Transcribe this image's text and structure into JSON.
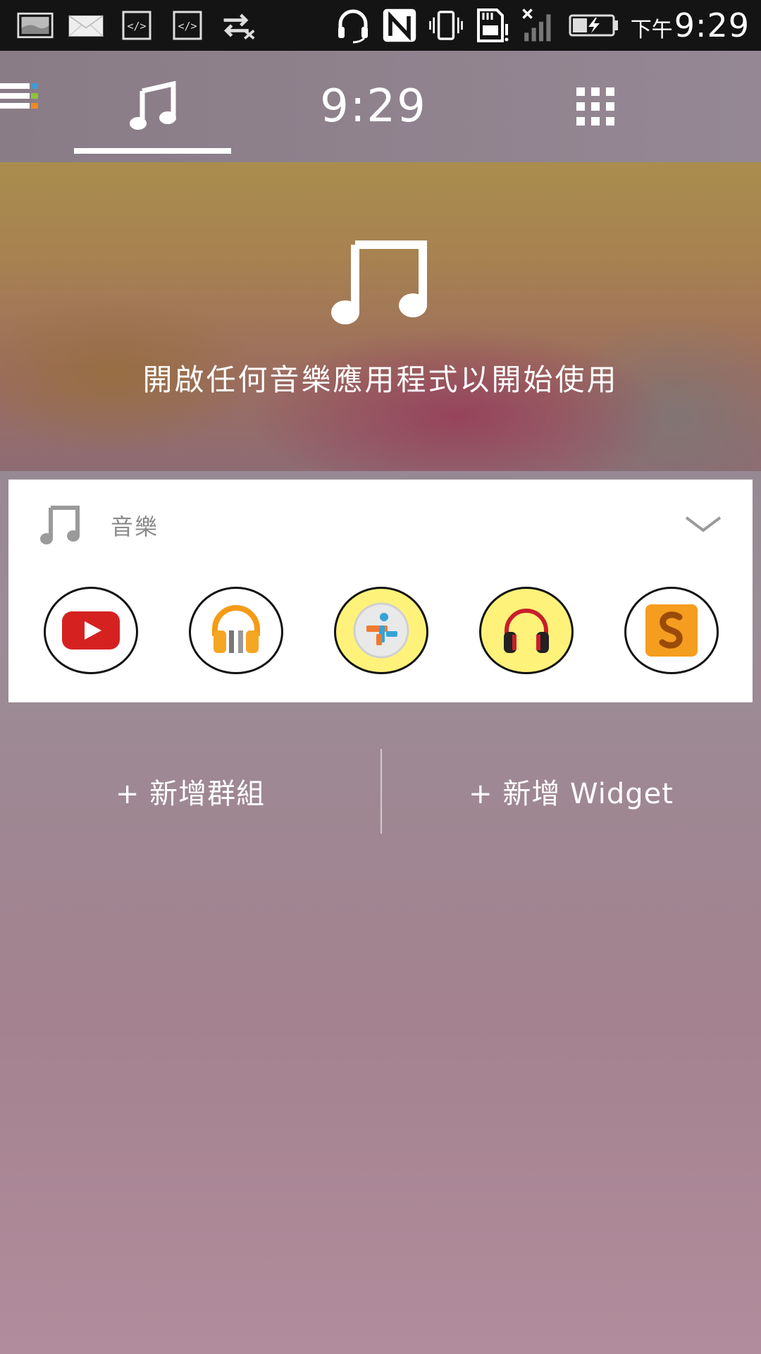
{
  "status_bar": {
    "ampm": "下午",
    "time": "9:29",
    "icons": [
      "image-notification-icon",
      "mail-icon",
      "code-icon",
      "code-icon",
      "data-transfer-icon",
      "headset-icon",
      "nfc-icon",
      "vibrate-icon",
      "sd-card-alert-icon",
      "no-signal-icon",
      "battery-charging-icon"
    ]
  },
  "tabs": {
    "music_icon": "music-note-icon",
    "clock": "9:29",
    "apps_icon": "grid-icon"
  },
  "hero": {
    "message": "開啟任何音樂應用程式以開始使用"
  },
  "music_card": {
    "title": "音樂",
    "apps": [
      "youtube-icon",
      "google-play-music-icon",
      "tunein-icon",
      "beats-headphones-icon",
      "soundhound-icon"
    ]
  },
  "actions": {
    "add_group": "+ 新增群組",
    "add_widget": "+ 新增 Widget"
  },
  "colors": {
    "accent_blue": "#3f9bd6",
    "accent_green": "#8fc43a",
    "accent_orange": "#f08a24"
  }
}
